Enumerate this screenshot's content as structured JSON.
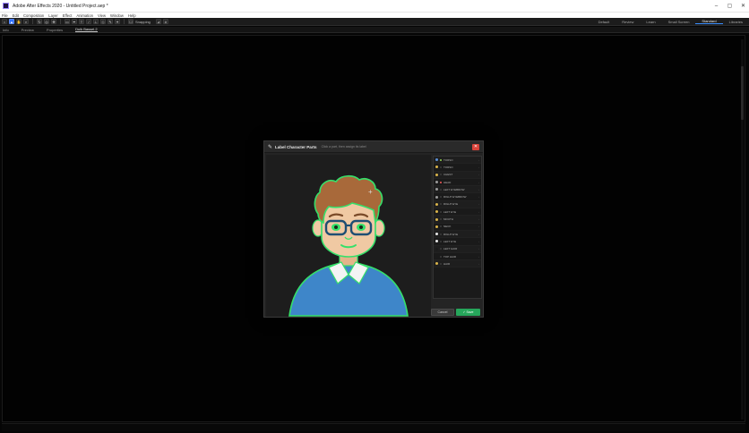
{
  "window": {
    "title": "Adobe After Effects 2020 - Untitled Project.aep *",
    "controls": [
      "–",
      "▢",
      "✕"
    ]
  },
  "menu": [
    "File",
    "Edit",
    "Composition",
    "Layer",
    "Effect",
    "Animation",
    "View",
    "Window",
    "Help"
  ],
  "toolbar": {
    "snapping_label": "Snapping",
    "workspaces": [
      "Default",
      "Review",
      "Learn",
      "Small Screen",
      "Standard",
      "Libraries"
    ],
    "active_workspace_index": 4
  },
  "panel_tabs": [
    "Info",
    "Preview",
    "Properties",
    "Duik Bassel.2"
  ],
  "active_panel_tab_index": 3,
  "modal": {
    "title": "Label Character Parts",
    "subtitle": "Click a part, then assign its label",
    "close_label": "✕",
    "cancel_label": "Cancel",
    "save_label": "✓ Save",
    "colors": {
      "accent_green": "#26a65b",
      "close_red": "#d9433a",
      "outline_green": "#35e06a",
      "hair": "#a8693a",
      "skin": "#f0c9a3",
      "shirt": "#3e86c9",
      "glasses": "#1f4e73"
    },
    "parts": [
      {
        "label": "TORSO",
        "dot": "#5b8fd6",
        "swatch": "#7a4",
        "accent": "#4a9a6a"
      },
      {
        "label": "TORSO",
        "dot": "#d9b44a",
        "swatch": "#333"
      },
      {
        "label": "CHEST",
        "dot": "#d9b44a",
        "swatch": "#333"
      },
      {
        "label": "HEAD",
        "dot": "#9a9a9a",
        "swatch": "#c04a4a"
      },
      {
        "label": "LEFT EYEBROW",
        "dot": "#9a9a9a",
        "swatch": "#333"
      },
      {
        "label": "RIGHT EYEBROW",
        "dot": "#9a9a9a",
        "swatch": "#333"
      },
      {
        "label": "RIGHT EYE",
        "dot": "#d9b44a",
        "swatch": "#333"
      },
      {
        "label": "LEFT EYE",
        "dot": "#d9b44a",
        "swatch": "#333"
      },
      {
        "label": "MOUTH",
        "dot": "#d9b44a",
        "swatch": "#333"
      },
      {
        "label": "NECK",
        "dot": "#d9b44a",
        "swatch": "#333"
      },
      {
        "label": "RIGHT EYE",
        "dot": "#e6e6e6",
        "swatch": "#333"
      },
      {
        "label": "LEFT EYE",
        "dot": "#e6e6e6",
        "swatch": "#333"
      },
      {
        "label": "LEFT HAIR",
        "dot": "#1a1a1a",
        "swatch": "#333"
      },
      {
        "label": "TOP HAIR",
        "dot": "#1a1a1a",
        "swatch": "#333"
      },
      {
        "label": "HAIR",
        "dot": "#d9b44a",
        "swatch": "#333"
      }
    ]
  }
}
